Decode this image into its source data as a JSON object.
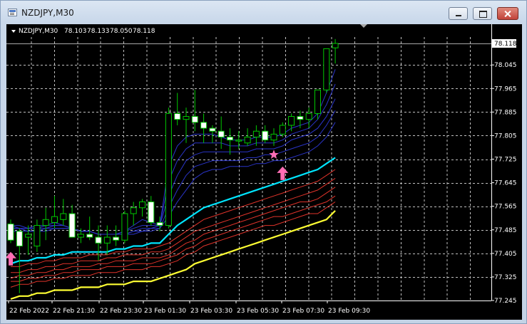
{
  "window": {
    "title": "NZDJPY,M30",
    "icon": "chart-window-icon",
    "buttons": [
      "minimize-button",
      "maximize-button",
      "close-button"
    ]
  },
  "chart_header": {
    "symbol": "NZDJPY,M30",
    "open": "78.103",
    "high": "78.133",
    "low": "78.050",
    "close": "78.118"
  },
  "chart_data": {
    "type": "candlestick",
    "y_ticks": [
      "78.118",
      "78.045",
      "77.965",
      "77.885",
      "77.805",
      "77.725",
      "77.645",
      "77.565",
      "77.485",
      "77.405",
      "77.325",
      "77.245"
    ],
    "x_ticks": [
      "22 Feb 2022",
      "22 Feb 21:30",
      "22 Feb 23:30",
      "23 Feb 01:30",
      "23 Feb 03:30",
      "23 Feb 05:30",
      "23 Feb 07:30",
      "23 Feb 09:30"
    ],
    "current_price": "78.118",
    "ylim": [
      77.245,
      78.17
    ],
    "grid": true,
    "colors": {
      "background": "#000000",
      "bull_candle": "#00c800",
      "grid": "#c0c0c0",
      "ma_fast": "#2a34c8",
      "ma_mid": "#00e5ff",
      "ma_slow": "#e0332a",
      "ma_slowest": "#ffff33",
      "signal": "#ff6eb4"
    },
    "candles": [
      {
        "o": 77.505,
        "h": 77.52,
        "l": 77.44,
        "c": 77.45
      },
      {
        "o": 77.48,
        "h": 77.49,
        "l": 77.27,
        "c": 77.43
      },
      {
        "o": 77.46,
        "h": 77.5,
        "l": 77.4,
        "c": 77.47
      },
      {
        "o": 77.43,
        "h": 77.52,
        "l": 77.41,
        "c": 77.5
      },
      {
        "o": 77.5,
        "h": 77.56,
        "l": 77.45,
        "c": 77.52
      },
      {
        "o": 77.51,
        "h": 77.6,
        "l": 77.49,
        "c": 77.53
      },
      {
        "o": 77.52,
        "h": 77.59,
        "l": 77.5,
        "c": 77.54
      },
      {
        "o": 77.54,
        "h": 77.57,
        "l": 77.5,
        "c": 77.46
      },
      {
        "o": 77.46,
        "h": 77.49,
        "l": 77.44,
        "c": 77.47
      },
      {
        "o": 77.47,
        "h": 77.53,
        "l": 77.45,
        "c": 77.46
      },
      {
        "o": 77.46,
        "h": 77.5,
        "l": 77.38,
        "c": 77.44
      },
      {
        "o": 77.44,
        "h": 77.5,
        "l": 77.4,
        "c": 77.46
      },
      {
        "o": 77.46,
        "h": 77.5,
        "l": 77.43,
        "c": 77.45
      },
      {
        "o": 77.45,
        "h": 77.55,
        "l": 77.44,
        "c": 77.54
      },
      {
        "o": 77.54,
        "h": 77.58,
        "l": 77.5,
        "c": 77.56
      },
      {
        "o": 77.56,
        "h": 77.59,
        "l": 77.53,
        "c": 77.58
      },
      {
        "o": 77.58,
        "h": 77.6,
        "l": 77.5,
        "c": 77.51
      },
      {
        "o": 77.51,
        "h": 77.53,
        "l": 77.48,
        "c": 77.5
      },
      {
        "o": 77.5,
        "h": 77.9,
        "l": 77.49,
        "c": 77.88
      },
      {
        "o": 77.88,
        "h": 77.95,
        "l": 77.84,
        "c": 77.86
      },
      {
        "o": 77.86,
        "h": 77.9,
        "l": 77.78,
        "c": 77.87
      },
      {
        "o": 77.87,
        "h": 77.96,
        "l": 77.82,
        "c": 77.85
      },
      {
        "o": 77.85,
        "h": 77.88,
        "l": 77.78,
        "c": 77.83
      },
      {
        "o": 77.83,
        "h": 77.84,
        "l": 77.78,
        "c": 77.82
      },
      {
        "o": 77.82,
        "h": 77.87,
        "l": 77.76,
        "c": 77.8
      },
      {
        "o": 77.8,
        "h": 77.83,
        "l": 77.74,
        "c": 77.79
      },
      {
        "o": 77.79,
        "h": 77.82,
        "l": 77.76,
        "c": 77.79
      },
      {
        "o": 77.78,
        "h": 77.83,
        "l": 77.77,
        "c": 77.8
      },
      {
        "o": 77.8,
        "h": 77.84,
        "l": 77.77,
        "c": 77.82
      },
      {
        "o": 77.82,
        "h": 77.84,
        "l": 77.78,
        "c": 77.79
      },
      {
        "o": 77.79,
        "h": 77.83,
        "l": 77.77,
        "c": 77.81
      },
      {
        "o": 77.81,
        "h": 77.85,
        "l": 77.8,
        "c": 77.84
      },
      {
        "o": 77.84,
        "h": 77.88,
        "l": 77.82,
        "c": 77.87
      },
      {
        "o": 77.87,
        "h": 77.89,
        "l": 77.83,
        "c": 77.86
      },
      {
        "o": 77.86,
        "h": 77.9,
        "l": 77.83,
        "c": 77.88
      },
      {
        "o": 77.88,
        "h": 77.96,
        "l": 77.86,
        "c": 77.96
      },
      {
        "o": 77.96,
        "h": 78.1,
        "l": 77.95,
        "c": 78.1
      },
      {
        "o": 78.103,
        "h": 78.133,
        "l": 78.05,
        "c": 78.118
      }
    ],
    "ma_lines": [
      {
        "color": "#2a34c8",
        "values": [
          77.5,
          77.5,
          77.49,
          77.5,
          77.5,
          77.51,
          77.5,
          77.49,
          77.48,
          77.48,
          77.47,
          77.47,
          77.47,
          77.48,
          77.5,
          77.52,
          77.51,
          77.5,
          77.7,
          77.77,
          77.8,
          77.81,
          77.81,
          77.81,
          77.8,
          77.79,
          77.79,
          77.79,
          77.8,
          77.8,
          77.8,
          77.81,
          77.83,
          77.84,
          77.85,
          77.88,
          77.95,
          78.03
        ]
      },
      {
        "color": "#2a34c8",
        "values": [
          77.5,
          77.49,
          77.49,
          77.49,
          77.5,
          77.5,
          77.5,
          77.49,
          77.48,
          77.48,
          77.47,
          77.47,
          77.47,
          77.48,
          77.49,
          77.5,
          77.5,
          77.5,
          77.65,
          77.72,
          77.76,
          77.78,
          77.78,
          77.78,
          77.78,
          77.77,
          77.77,
          77.77,
          77.78,
          77.78,
          77.78,
          77.79,
          77.81,
          77.82,
          77.83,
          77.86,
          77.91,
          77.98
        ]
      },
      {
        "color": "#2a34c8",
        "values": [
          77.49,
          77.49,
          77.49,
          77.49,
          77.49,
          77.5,
          77.5,
          77.49,
          77.48,
          77.48,
          77.47,
          77.47,
          77.47,
          77.47,
          77.48,
          77.49,
          77.49,
          77.5,
          77.6,
          77.67,
          77.72,
          77.74,
          77.75,
          77.75,
          77.75,
          77.75,
          77.75,
          77.75,
          77.76,
          77.76,
          77.76,
          77.77,
          77.79,
          77.8,
          77.81,
          77.83,
          77.87,
          77.93
        ]
      },
      {
        "color": "#2a34c8",
        "values": [
          77.49,
          77.49,
          77.48,
          77.48,
          77.49,
          77.49,
          77.49,
          77.49,
          77.48,
          77.48,
          77.47,
          77.47,
          77.47,
          77.47,
          77.48,
          77.48,
          77.49,
          77.49,
          77.56,
          77.62,
          77.67,
          77.7,
          77.71,
          77.72,
          77.72,
          77.72,
          77.72,
          77.73,
          77.73,
          77.74,
          77.74,
          77.75,
          77.76,
          77.77,
          77.78,
          77.8,
          77.84,
          77.89
        ]
      },
      {
        "color": "#2a34c8",
        "values": [
          77.48,
          77.48,
          77.48,
          77.48,
          77.48,
          77.49,
          77.49,
          77.49,
          77.48,
          77.48,
          77.47,
          77.47,
          77.47,
          77.47,
          77.47,
          77.48,
          77.48,
          77.49,
          77.53,
          77.58,
          77.62,
          77.66,
          77.68,
          77.69,
          77.69,
          77.7,
          77.7,
          77.7,
          77.71,
          77.71,
          77.72,
          77.72,
          77.73,
          77.74,
          77.75,
          77.77,
          77.8,
          77.85
        ]
      },
      {
        "color": "#00e5ff",
        "values": [
          77.37,
          77.38,
          77.38,
          77.39,
          77.39,
          77.4,
          77.4,
          77.41,
          77.41,
          77.41,
          77.41,
          77.41,
          77.42,
          77.42,
          77.43,
          77.43,
          77.44,
          77.44,
          77.47,
          77.5,
          77.52,
          77.54,
          77.56,
          77.57,
          77.58,
          77.59,
          77.6,
          77.61,
          77.62,
          77.63,
          77.64,
          77.65,
          77.66,
          77.67,
          77.68,
          77.69,
          77.71,
          77.73
        ]
      },
      {
        "color": "#e0332a",
        "values": [
          77.36,
          77.36,
          77.37,
          77.37,
          77.38,
          77.38,
          77.39,
          77.39,
          77.39,
          77.4,
          77.4,
          77.4,
          77.41,
          77.41,
          77.42,
          77.42,
          77.42,
          77.43,
          77.44,
          77.46,
          77.48,
          77.5,
          77.52,
          77.53,
          77.54,
          77.55,
          77.56,
          77.57,
          77.58,
          77.59,
          77.6,
          77.61,
          77.62,
          77.63,
          77.64,
          77.65,
          77.67,
          77.69
        ]
      },
      {
        "color": "#e0332a",
        "values": [
          77.34,
          77.34,
          77.35,
          77.35,
          77.36,
          77.36,
          77.37,
          77.37,
          77.38,
          77.38,
          77.38,
          77.39,
          77.39,
          77.4,
          77.4,
          77.4,
          77.41,
          77.41,
          77.42,
          77.44,
          77.46,
          77.48,
          77.49,
          77.5,
          77.51,
          77.52,
          77.53,
          77.54,
          77.55,
          77.56,
          77.57,
          77.58,
          77.59,
          77.6,
          77.61,
          77.62,
          77.64,
          77.66
        ]
      },
      {
        "color": "#e0332a",
        "values": [
          77.32,
          77.33,
          77.33,
          77.34,
          77.34,
          77.35,
          77.35,
          77.36,
          77.36,
          77.36,
          77.37,
          77.37,
          77.38,
          77.38,
          77.38,
          77.39,
          77.39,
          77.39,
          77.4,
          77.42,
          77.44,
          77.45,
          77.47,
          77.48,
          77.49,
          77.5,
          77.51,
          77.52,
          77.53,
          77.54,
          77.55,
          77.56,
          77.57,
          77.58,
          77.58,
          77.59,
          77.61,
          77.63
        ]
      },
      {
        "color": "#e0332a",
        "values": [
          77.31,
          77.31,
          77.32,
          77.32,
          77.33,
          77.33,
          77.34,
          77.34,
          77.35,
          77.35,
          77.35,
          77.36,
          77.36,
          77.36,
          77.37,
          77.37,
          77.37,
          77.38,
          77.39,
          77.4,
          77.42,
          77.43,
          77.45,
          77.46,
          77.47,
          77.48,
          77.49,
          77.5,
          77.51,
          77.52,
          77.53,
          77.53,
          77.54,
          77.55,
          77.56,
          77.57,
          77.58,
          77.6
        ]
      },
      {
        "color": "#e0332a",
        "values": [
          77.29,
          77.3,
          77.3,
          77.31,
          77.31,
          77.32,
          77.32,
          77.33,
          77.33,
          77.33,
          77.34,
          77.34,
          77.34,
          77.35,
          77.35,
          77.35,
          77.36,
          77.36,
          77.37,
          77.38,
          77.4,
          77.41,
          77.43,
          77.44,
          77.45,
          77.46,
          77.47,
          77.48,
          77.49,
          77.5,
          77.5,
          77.51,
          77.52,
          77.53,
          77.54,
          77.54,
          77.56,
          77.58
        ]
      },
      {
        "color": "#ffff33",
        "values": [
          77.25,
          77.26,
          77.26,
          77.27,
          77.27,
          77.28,
          77.28,
          77.28,
          77.29,
          77.29,
          77.29,
          77.3,
          77.3,
          77.3,
          77.31,
          77.31,
          77.31,
          77.32,
          77.33,
          77.34,
          77.35,
          77.37,
          77.38,
          77.39,
          77.4,
          77.41,
          77.42,
          77.43,
          77.44,
          77.45,
          77.46,
          77.47,
          77.48,
          77.49,
          77.5,
          77.51,
          77.52,
          77.55
        ]
      }
    ],
    "signals": [
      {
        "type": "up-arrow",
        "index": 0,
        "price": 77.41
      },
      {
        "type": "star",
        "index": 30,
        "price": 77.74
      },
      {
        "type": "up-arrow",
        "index": 31,
        "price": 77.7
      }
    ]
  }
}
